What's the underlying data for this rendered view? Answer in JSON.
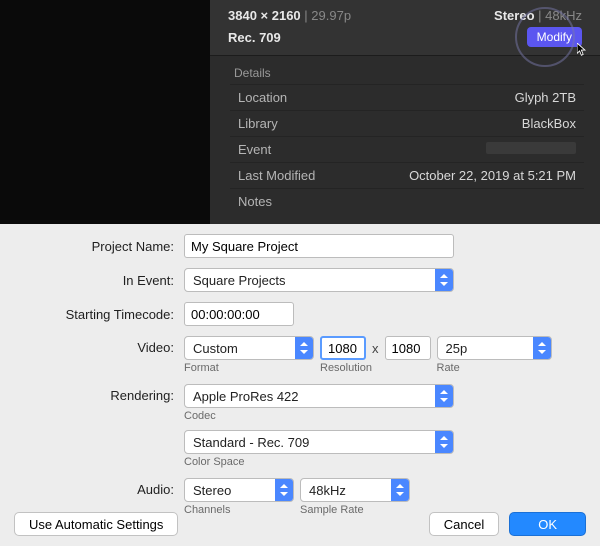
{
  "inspector": {
    "resolution": "3840 × 2160",
    "frame_rate_top": "29.97p",
    "stereo": "Stereo",
    "khz": "48kHz",
    "rec": "Rec. 709",
    "modify_btn": "Modify",
    "details_header": "Details",
    "rows": {
      "location_label": "Location",
      "location_value": "Glyph 2TB",
      "library_label": "Library",
      "library_value": "BlackBox",
      "event_label": "Event",
      "last_modified_label": "Last Modified",
      "last_modified_value": "October 22, 2019 at 5:21 PM",
      "notes_label": "Notes"
    }
  },
  "dialog": {
    "project_name_label": "Project Name:",
    "project_name_value": "My Square Project",
    "in_event_label": "In Event:",
    "in_event_value": "Square Projects",
    "starting_tc_label": "Starting Timecode:",
    "starting_tc_value": "00:00:00:00",
    "video_label": "Video:",
    "video_format_value": "Custom",
    "video_format_sub": "Format",
    "video_res_w": "1080",
    "video_res_h": "1080",
    "video_res_sub": "Resolution",
    "video_rate_value": "25p",
    "video_rate_sub": "Rate",
    "rendering_label": "Rendering:",
    "codec_value": "Apple ProRes 422",
    "codec_sub": "Codec",
    "colorspace_value": "Standard - Rec. 709",
    "colorspace_sub": "Color Space",
    "audio_label": "Audio:",
    "audio_channels_value": "Stereo",
    "audio_channels_sub": "Channels",
    "audio_rate_value": "48kHz",
    "audio_rate_sub": "Sample Rate",
    "auto_btn": "Use Automatic Settings",
    "cancel_btn": "Cancel",
    "ok_btn": "OK"
  }
}
